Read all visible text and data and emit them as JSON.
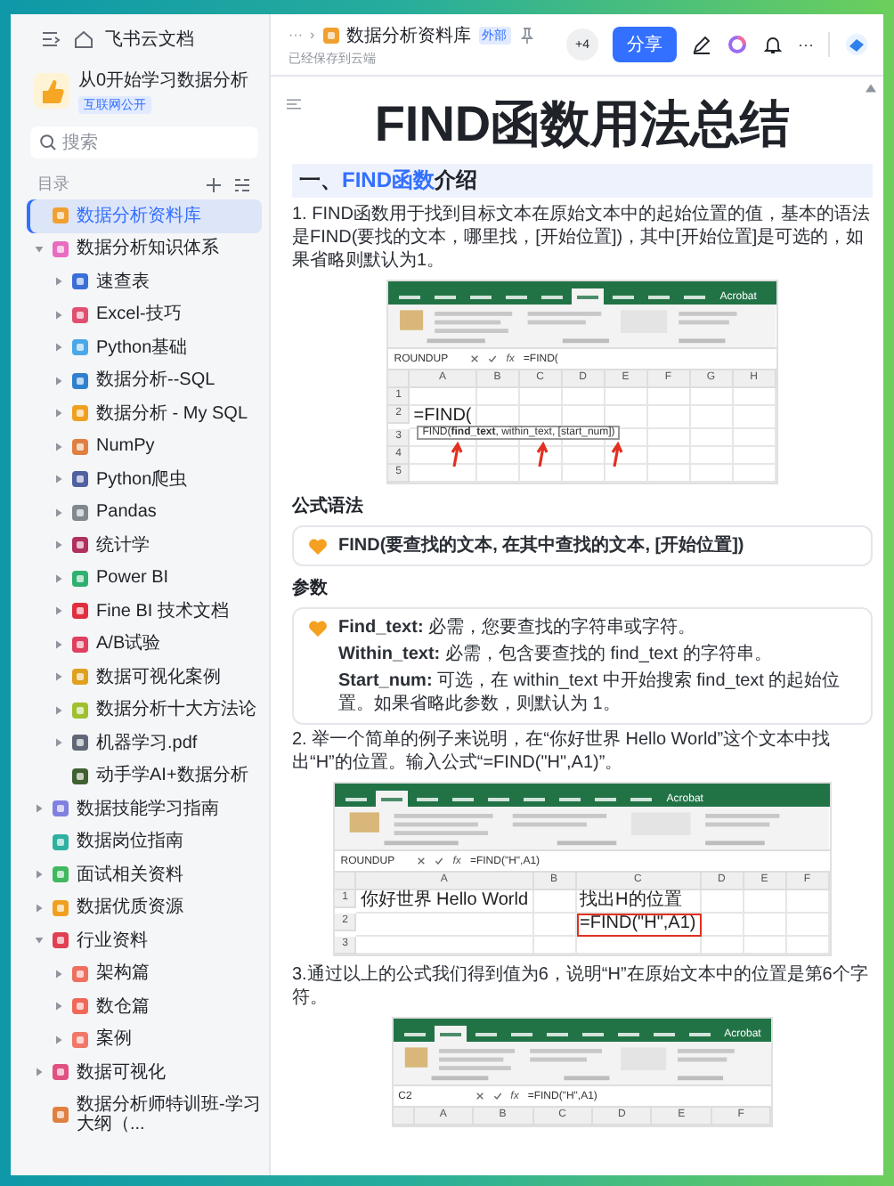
{
  "sidebar": {
    "header": {
      "title": "飞书云文档"
    },
    "space": {
      "title": "从0开始学习数据分析",
      "badge": "互联网公开"
    },
    "search": {
      "placeholder": "搜索"
    },
    "section_label": "目录",
    "tree": [
      {
        "label": "数据分析资料库",
        "color": "#f0a030",
        "selected": true
      },
      {
        "label": "数据分析知识体系",
        "color": "#e86cc0",
        "selected": false,
        "expanded": true,
        "children": [
          {
            "label": "速查表",
            "color": "#3b6fd8",
            "selected": false,
            "expanded": false
          },
          {
            "label": "Excel-技巧",
            "color": "#e05070",
            "selected": false,
            "expanded": false
          },
          {
            "label": "Python基础",
            "color": "#4aa8e8",
            "selected": false,
            "expanded": false
          },
          {
            "label": "数据分析--SQL",
            "color": "#3080d0",
            "selected": false,
            "expanded": false
          },
          {
            "label": "数据分析 - My SQL",
            "color": "#f0a020",
            "selected": false,
            "expanded": false
          },
          {
            "label": "NumPy",
            "color": "#e08040",
            "selected": false,
            "expanded": false
          },
          {
            "label": "Python爬虫",
            "color": "#5060a0",
            "selected": false,
            "expanded": false
          },
          {
            "label": "Pandas",
            "color": "#808890",
            "selected": false,
            "expanded": false
          },
          {
            "label": "统计学",
            "color": "#b03060",
            "selected": false,
            "expanded": false
          },
          {
            "label": "Power BI",
            "color": "#30b070",
            "selected": false,
            "expanded": false
          },
          {
            "label": "Fine BI 技术文档",
            "color": "#e03040",
            "selected": false,
            "expanded": false
          },
          {
            "label": "A/B试验",
            "color": "#e04060",
            "selected": false,
            "expanded": false
          },
          {
            "label": "数据可视化案例",
            "color": "#e0a020",
            "selected": false,
            "expanded": false
          },
          {
            "label": "数据分析十大方法论",
            "color": "#a0c030",
            "selected": false,
            "expanded": false
          },
          {
            "label": "机器学习.pdf",
            "color": "#606878",
            "selected": false,
            "expanded": false
          },
          {
            "label": "动手学AI+数据分析",
            "color": "#406030",
            "selected": false
          }
        ]
      },
      {
        "label": "数据技能学习指南",
        "color": "#8080e0",
        "selected": false,
        "expanded": false
      },
      {
        "label": "数据岗位指南",
        "color": "#30b0a0",
        "selected": false
      },
      {
        "label": "面试相关资料",
        "color": "#40b860",
        "selected": false,
        "expanded": false
      },
      {
        "label": "数据优质资源",
        "color": "#f0a020",
        "selected": false,
        "expanded": false
      },
      {
        "label": "行业资料",
        "color": "#e04050",
        "selected": false,
        "expanded": true,
        "children": [
          {
            "label": "架构篇",
            "color": "#f07060",
            "selected": false,
            "expanded": false
          },
          {
            "label": "数仓篇",
            "color": "#f06858",
            "selected": false,
            "expanded": false
          },
          {
            "label": "案例",
            "color": "#f07868",
            "selected": false,
            "expanded": false
          }
        ]
      },
      {
        "label": "数据可视化",
        "color": "#e05080",
        "selected": false,
        "expanded": false
      },
      {
        "label": "数据分析师特训班-学习大纲（...",
        "color": "#e08040",
        "selected": false
      }
    ]
  },
  "doc_header": {
    "more": "···",
    "separator": "›",
    "title": "数据分析资料库",
    "badge": "外部",
    "save_status": "已经保存到云端"
  },
  "toolbar": {
    "collaborators": "+4",
    "share": "分享",
    "more": "···"
  },
  "document": {
    "title": "FIND函数用法总结",
    "blocks": [
      {
        "kind": "heading",
        "segments": [
          {
            "text": "一、",
            "highlight": false
          },
          {
            "text": "FIND函数",
            "highlight": true
          },
          {
            "text": "介绍",
            "highlight": false
          }
        ]
      },
      {
        "kind": "paragraph",
        "text": "1. FIND函数用于找到目标文本在原始文本中的起始位置的值，基本的语法是FIND(要找的文本，哪里找，[开始位置])，其中[开始位置]是可选的，如果省略则默认为1。"
      },
      {
        "kind": "sheet",
        "tabs": [
          {
            "selected": false
          },
          {
            "selected": false
          },
          {
            "selected": false
          },
          {
            "selected": false
          },
          {
            "selected": false
          },
          {
            "selected": true
          },
          {
            "selected": false
          },
          {
            "selected": false
          },
          {
            "selected": false
          },
          {
            "label": "Acrobat",
            "selected": false
          }
        ],
        "name_box": "ROUNDUP",
        "function_label": "fx",
        "formula": "=FIND(",
        "columns": [
          "A",
          "B",
          "C",
          "D",
          "E",
          "F",
          "G",
          "H"
        ],
        "rows": [
          {
            "label": "1",
            "cells": []
          },
          {
            "label": "2",
            "cells": [
              {
                "text": "=FIND(",
                "boxed": false
              }
            ]
          },
          {
            "label": "3",
            "cells": []
          },
          {
            "label": "4",
            "cells": []
          },
          {
            "label": "5",
            "cells": []
          }
        ],
        "hint": "FIND(**find_text**, within_text, [start_num])"
      },
      {
        "kind": "label",
        "text": "公式语法"
      },
      {
        "kind": "callout",
        "emphasis": true,
        "lines": [
          "FIND(要查找的文本, 在其中查找的文本, [开始位置])"
        ]
      },
      {
        "kind": "label",
        "text": "参数"
      },
      {
        "kind": "callout",
        "emphasis": false,
        "lines": [
          "**Find_text:** 必需，您要查找的字符串或字符。",
          "**Within_text:** 必需，包含要查找的 find_text 的字符串。",
          "**Start_num:** 可选，在 within_text 中开始搜索 find_text 的起始位置。如果省略此参数，则默认为 1。"
        ]
      },
      {
        "kind": "paragraph",
        "text": "2. 举一个简单的例子来说明，在“你好世界 Hello World”这个文本中找出“H”的位置。输入公式“=FIND(\"H\",A1)”。"
      },
      {
        "kind": "sheet",
        "tabs": [
          {
            "selected": false
          },
          {
            "selected": true
          },
          {
            "selected": false
          },
          {
            "selected": false
          },
          {
            "selected": false
          },
          {
            "selected": false
          },
          {
            "selected": false
          },
          {
            "selected": false
          },
          {
            "selected": false
          },
          {
            "label": "Acrobat",
            "selected": false
          }
        ],
        "name_box": "ROUNDUP",
        "function_label": "fx",
        "formula": "=FIND(\"H\",A1)",
        "columns": [
          "A",
          "B",
          "C",
          "D",
          "E",
          "F"
        ],
        "rows": [
          {
            "label": "1",
            "cells": [
              {
                "text": "你好世界 Hello World",
                "boxed": false
              },
              {},
              {
                "text": "找出H的位置",
                "boxed": false
              }
            ]
          },
          {
            "label": "2",
            "cells": [
              {},
              {},
              {
                "text": "=FIND(\"H\",A1)",
                "boxed": true
              }
            ]
          },
          {
            "label": "3",
            "cells": []
          }
        ]
      },
      {
        "kind": "paragraph",
        "text": "3.通过以上的公式我们得到值为6，说明“H”在原始文本中的位置是第6个字符。"
      },
      {
        "kind": "sheet",
        "tabs": [
          {
            "selected": false
          },
          {
            "selected": true
          },
          {
            "selected": false
          },
          {
            "selected": false
          },
          {
            "selected": false
          },
          {
            "selected": false
          },
          {
            "selected": false
          },
          {
            "selected": false
          },
          {
            "selected": false
          },
          {
            "label": "Acrobat",
            "selected": false
          }
        ],
        "name_box": "C2",
        "function_label": "fx",
        "formula": "=FIND(\"H\",A1)",
        "columns": [
          "A",
          "B",
          "C",
          "D",
          "E",
          "F"
        ]
      }
    ]
  }
}
